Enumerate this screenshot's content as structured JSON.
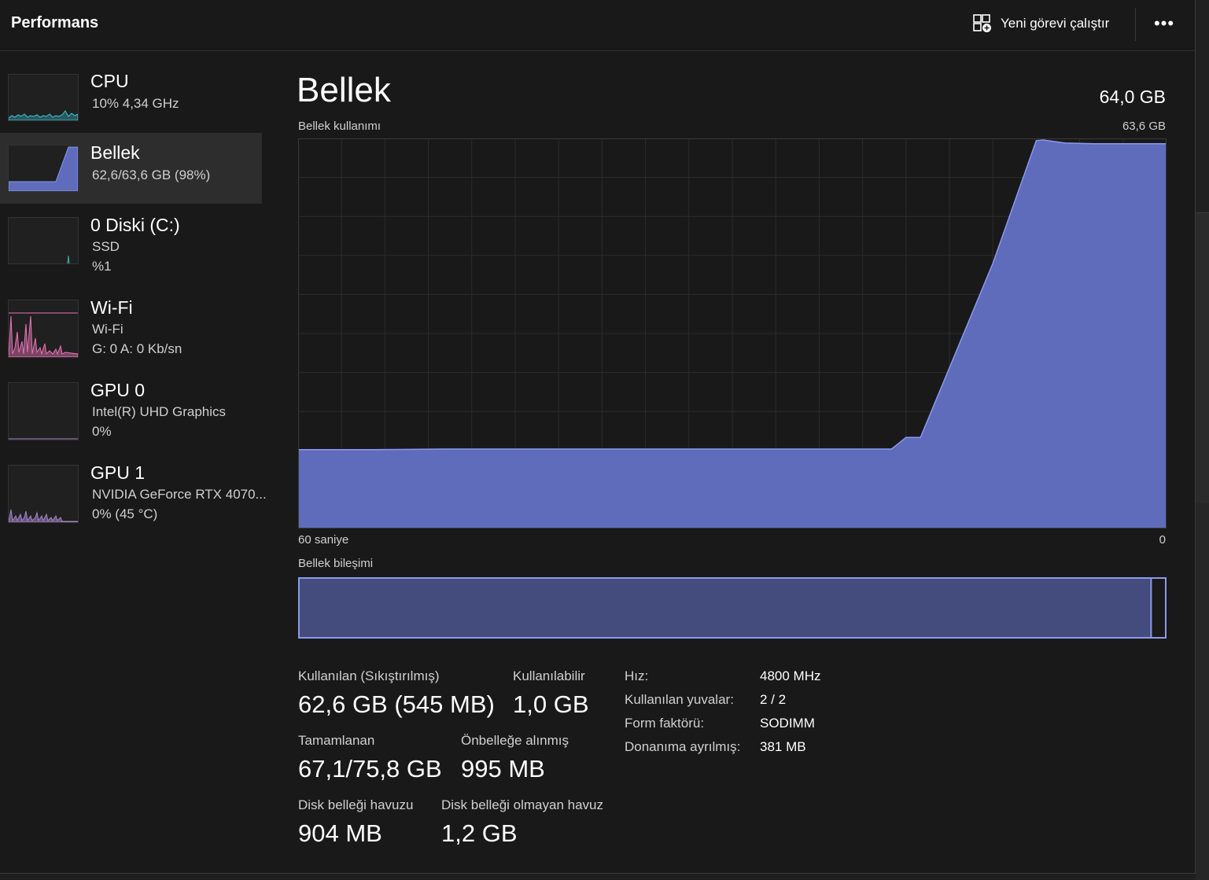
{
  "header": {
    "title": "Performans",
    "new_task_label": "Yeni görevi çalıştır",
    "more_label": "•••"
  },
  "sidebar": {
    "items": [
      {
        "name": "CPU",
        "sub1": "10%  4,34 GHz",
        "sub2": "",
        "color": "#3ec3d6"
      },
      {
        "name": "Bellek",
        "sub1": "62,6/63,6 GB (98%)",
        "sub2": "",
        "color": "#6a7ad8",
        "selected": true
      },
      {
        "name": "0 Diski (C:)",
        "sub1": "SSD",
        "sub2": "%1",
        "color": "#2fb39d"
      },
      {
        "name": "Wi-Fi",
        "sub1": "Wi-Fi",
        "sub2": "G: 0  A: 0 Kb/sn",
        "color": "#e874b6"
      },
      {
        "name": "GPU 0",
        "sub1": "Intel(R) UHD Graphics",
        "sub2": "0%",
        "color": "#a682c9"
      },
      {
        "name": "GPU 1",
        "sub1": "NVIDIA GeForce RTX 4070...",
        "sub2": "0%  (45 °C)",
        "color": "#a682c9"
      }
    ]
  },
  "main": {
    "title": "Bellek",
    "total": "64,0 GB",
    "usage_label": "Bellek kullanımı",
    "usage_max": "63,6 GB",
    "axis_left": "60 saniye",
    "axis_right": "0",
    "composition_label": "Bellek bileşimi",
    "composition": {
      "in_use_fraction": 0.984
    },
    "stats": {
      "in_use_label": "Kullanılan (Sıkıştırılmış)",
      "in_use_value": "62,6 GB (545 MB)",
      "available_label": "Kullanılabilir",
      "available_value": "1,0 GB",
      "committed_label": "Tamamlanan",
      "committed_value": "67,1/75,8 GB",
      "cached_label": "Önbelleğe alınmış",
      "cached_value": "995 MB",
      "paged_label": "Disk belleği havuzu",
      "paged_value": "904 MB",
      "nonpaged_label": "Disk belleği olmayan havuz",
      "nonpaged_value": "1,2 GB"
    },
    "specs": {
      "speed_label": "Hız:",
      "speed_value": "4800 MHz",
      "slots_label": "Kullanılan yuvalar:",
      "slots_value": "2 / 2",
      "form_label": "Form faktörü:",
      "form_value": "SODIMM",
      "reserved_label": "Donanıma ayrılmış:",
      "reserved_value": "381 MB"
    }
  },
  "colors": {
    "memory_line": "#8c99ee",
    "memory_fill": "#5f6cbb",
    "grid": "#2c2c2c"
  },
  "chart_data": {
    "type": "area",
    "title": "Bellek kullanımı",
    "xlabel": "",
    "ylabel": "",
    "xlim": [
      60,
      0
    ],
    "ylim": [
      0,
      63.6
    ],
    "grid": true,
    "x": [
      60,
      55,
      50,
      45,
      40,
      35,
      30,
      25,
      20,
      19,
      18,
      17,
      12,
      9,
      8.5,
      7,
      5,
      0
    ],
    "series": [
      {
        "values": [
          12.9,
          12.9,
          13.0,
          13.0,
          13.0,
          13.0,
          13.0,
          13.0,
          13.0,
          13.0,
          14.9,
          14.9,
          43.4,
          63.5,
          63.6,
          63.1,
          63.0,
          63.0
        ]
      }
    ]
  }
}
